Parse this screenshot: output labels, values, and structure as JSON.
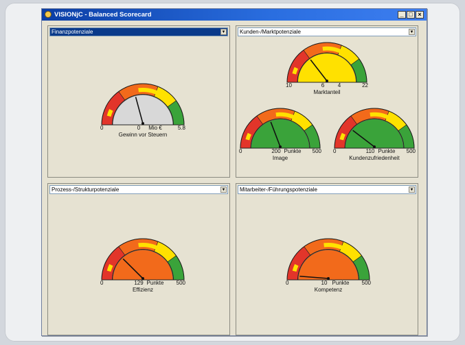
{
  "window": {
    "title": "VISIONjC - Balanced Scorecard",
    "buttons": {
      "minimize": "_",
      "maximize": "□",
      "close": "×"
    }
  },
  "panels": [
    {
      "title": "Finanzpotenziale",
      "gauges": [
        {
          "value": 0,
          "min": "0",
          "max": "5.8",
          "value_text": "0",
          "unit": "Mio €",
          "name": "Gewinn vor Steuern",
          "needle_fraction": 0.42,
          "fill": "#d8d8d8"
        }
      ]
    },
    {
      "title": "Kunden-/Marktpotenziale",
      "gauges": [
        {
          "value": 6,
          "min": "10",
          "max": "22",
          "value_text": "6",
          "unit": "4",
          "name": "Marktanteil",
          "needle_fraction": 0.3,
          "fill": "#ffe100"
        },
        {
          "value": 200,
          "min": "0",
          "max": "500",
          "value_text": "200",
          "unit": "Punkte",
          "name": "Image",
          "needle_fraction": 0.39,
          "fill": "#3aa33a"
        },
        {
          "value": 110,
          "min": "0",
          "max": "500",
          "value_text": "110",
          "unit": "Punkte",
          "name": "Kundenzufriedenheit",
          "needle_fraction": 0.22,
          "fill": "#3aa33a"
        }
      ]
    },
    {
      "title": "Prozess-/Strukturpotenziale",
      "gauges": [
        {
          "value": 129,
          "min": "0",
          "max": "500",
          "value_text": "129",
          "unit": "Punkte",
          "name": "Effizienz",
          "needle_fraction": 0.26,
          "fill": "#f26a1b"
        }
      ]
    },
    {
      "title": "Mitarbeiter-/Führungspotenziale",
      "gauges": [
        {
          "value": 10,
          "min": "0",
          "max": "500",
          "value_text": "10",
          "unit": "Punkte",
          "name": "Kompetenz",
          "needle_fraction": 0.04,
          "fill": "#f26a1b"
        }
      ]
    }
  ],
  "colors": {
    "red_band": "#e2352a",
    "orange_band": "#f26a1b",
    "yellow_band": "#ffe100",
    "green_band": "#3aa33a",
    "needle": "#111111"
  }
}
